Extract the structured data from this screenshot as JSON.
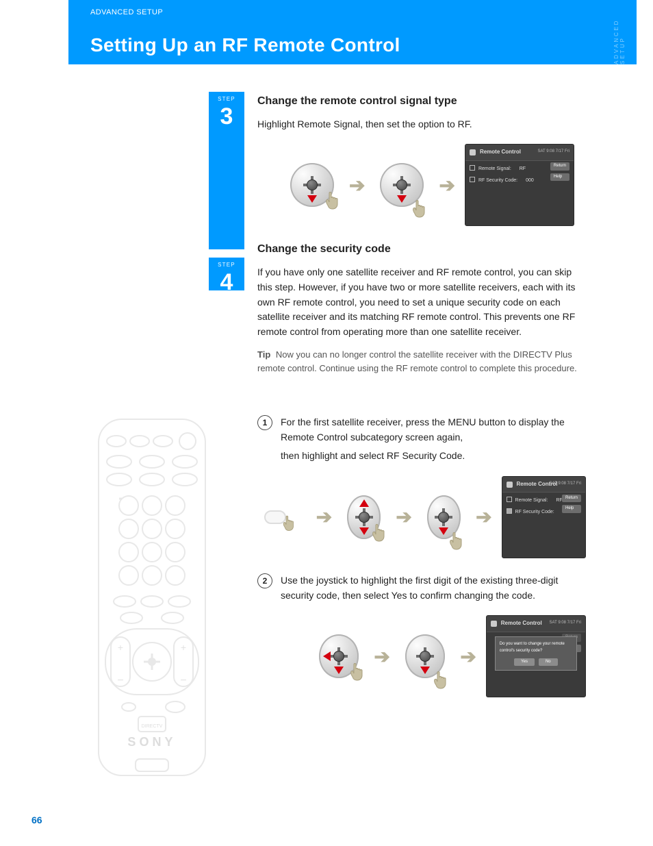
{
  "page_number": "66",
  "header": {
    "eyebrow": "Advanced Setup",
    "title": "Setting Up an RF Remote Control",
    "side_label": "Advanced Setup"
  },
  "step_badge": {
    "label": "Step",
    "num1": "3",
    "num2": "4"
  },
  "step3": {
    "heading": "Change the remote control signal type",
    "para": "Highlight Remote Signal, then set the option to RF.",
    "tip_label": "Tip",
    "tip": "Now you can no longer control the satellite receiver with the DIRECTV Plus remote control. Continue using the RF remote control to complete this procedure."
  },
  "step4": {
    "heading": "Change the security code",
    "intro": "If you have only one satellite receiver and RF remote control, you can skip this step. However, if you have two or more satellite receivers, each with its own RF remote control, you need to set a unique security code on each satellite receiver and its matching RF remote control. This prevents one RF remote control from operating more than one satellite receiver.",
    "s1": "For the first satellite receiver, press the MENU button to display the Remote Control subcategory screen again,",
    "s1b": "then highlight and select RF Security Code.",
    "s2": "Use the joystick to highlight the first digit of the existing three-digit security code, then select Yes to confirm changing the code."
  },
  "icons": {
    "dpad_down": "dpad-down-icon",
    "dpad_center": "dpad-center-icon",
    "dpad_updown": "dpad-up-down-icon",
    "dpad_leftdown": "dpad-left-down-icon",
    "menu_button": "menu-button-icon",
    "hand": "pointer-hand-icon",
    "arrow": "arrow-right-icon"
  },
  "shot": {
    "title": "Remote Control",
    "meta": "SAT 9:08  7/17 Fri",
    "row1_label": "Remote Signal:",
    "row1_value": "RF",
    "row2_label": "RF Security Code:",
    "row2_value": "000",
    "btn_return": "Return",
    "btn_help": "Help",
    "dialog_q": "Do you want to change your remote control's security code?",
    "dialog_yes": "Yes",
    "dialog_no": "No"
  },
  "remote": {
    "brand": "SONY",
    "directv": "DIRECTV"
  }
}
